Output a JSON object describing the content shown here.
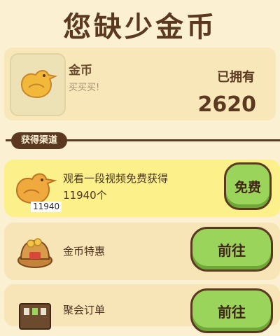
{
  "page": {
    "title": "您缺少金币"
  },
  "coin": {
    "name": "金币",
    "desc": "买买买!",
    "owned_label": "已拥有",
    "owned_count": "2620",
    "icon": "bird-coin-icon"
  },
  "section": {
    "label": "获得渠道"
  },
  "channels": [
    {
      "line1": "观看一段视频免费获得",
      "line2": "11940个",
      "badge": "11940",
      "button": "免费",
      "icon": "bird-cookie-icon"
    },
    {
      "line1": "金币特惠",
      "button": "前往",
      "icon": "coin-bag-icon"
    },
    {
      "line1": "聚会订单",
      "button": "前往",
      "icon": "order-board-icon"
    }
  ],
  "colors": {
    "background": "#FBF1D2",
    "card": "#F7E7B9",
    "highlight_row": "#FBF08A",
    "text_dark": "#5B3820",
    "button_green": "#9AD45A"
  }
}
